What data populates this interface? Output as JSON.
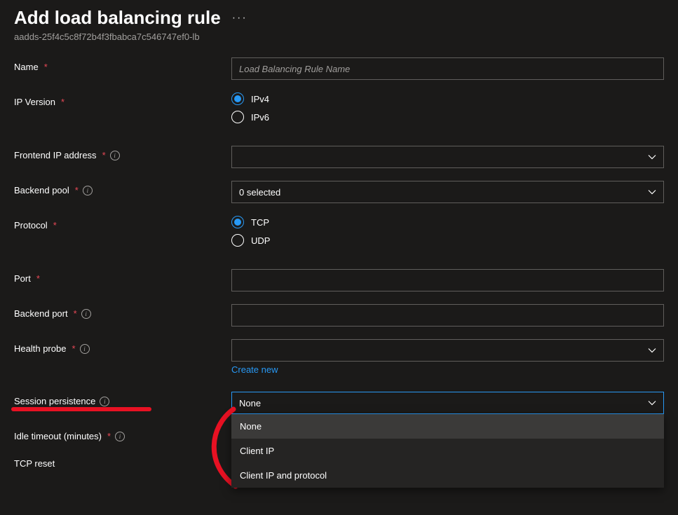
{
  "header": {
    "title": "Add load balancing rule",
    "subtitle": "aadds-25f4c5c8f72b4f3fbabca7c546747ef0-lb"
  },
  "fields": {
    "name": {
      "label": "Name",
      "placeholder": "Load Balancing Rule Name"
    },
    "ipVersion": {
      "label": "IP Version",
      "options": {
        "ipv4": "IPv4",
        "ipv6": "IPv6"
      },
      "selected": "ipv4"
    },
    "frontend": {
      "label": "Frontend IP address",
      "value": ""
    },
    "backendPool": {
      "label": "Backend pool",
      "value": "0 selected"
    },
    "protocol": {
      "label": "Protocol",
      "options": {
        "tcp": "TCP",
        "udp": "UDP"
      },
      "selected": "tcp"
    },
    "port": {
      "label": "Port"
    },
    "backendPort": {
      "label": "Backend port"
    },
    "healthProbe": {
      "label": "Health probe",
      "value": "",
      "createNew": "Create new"
    },
    "sessionPersistence": {
      "label": "Session persistence",
      "value": "None",
      "options": [
        "None",
        "Client IP",
        "Client IP and protocol"
      ]
    },
    "idleTimeout": {
      "label": "Idle timeout (minutes)"
    },
    "tcpReset": {
      "label": "TCP reset"
    }
  }
}
